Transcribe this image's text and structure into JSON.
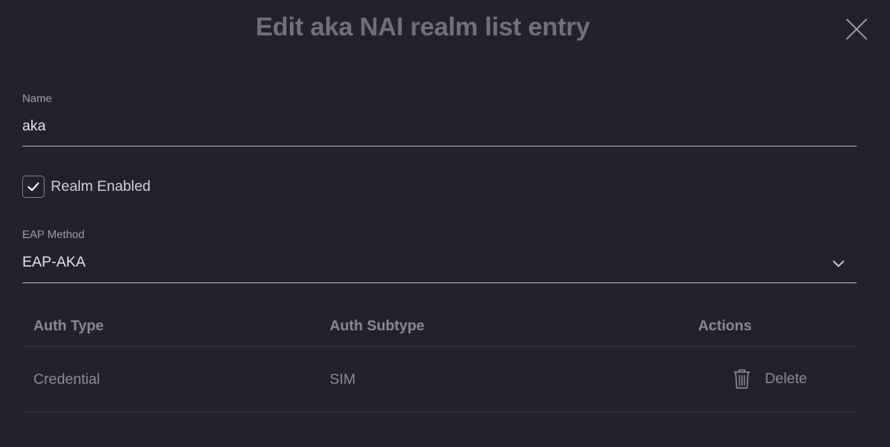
{
  "dialog": {
    "title": "Edit aka NAI realm list entry",
    "close_icon": "close-icon"
  },
  "name_field": {
    "label": "Name",
    "value": "aka"
  },
  "realm_enabled": {
    "label": "Realm Enabled",
    "checked": true,
    "icon": "checkmark-icon"
  },
  "eap_method": {
    "label": "EAP Method",
    "value": "EAP-AKA",
    "icon": "chevron-down-icon"
  },
  "table": {
    "headers": [
      "Auth Type",
      "Auth Subtype",
      "Actions"
    ],
    "rows": [
      {
        "auth_type": "Credential",
        "auth_subtype": "SIM",
        "action_label": "Delete",
        "action_icon": "trash-icon"
      }
    ]
  },
  "colors": {
    "background": "#22222d",
    "title": "#6f707c",
    "text": "#e3e4ea",
    "muted": "#8a8b96",
    "divider": "#3a3b47"
  }
}
